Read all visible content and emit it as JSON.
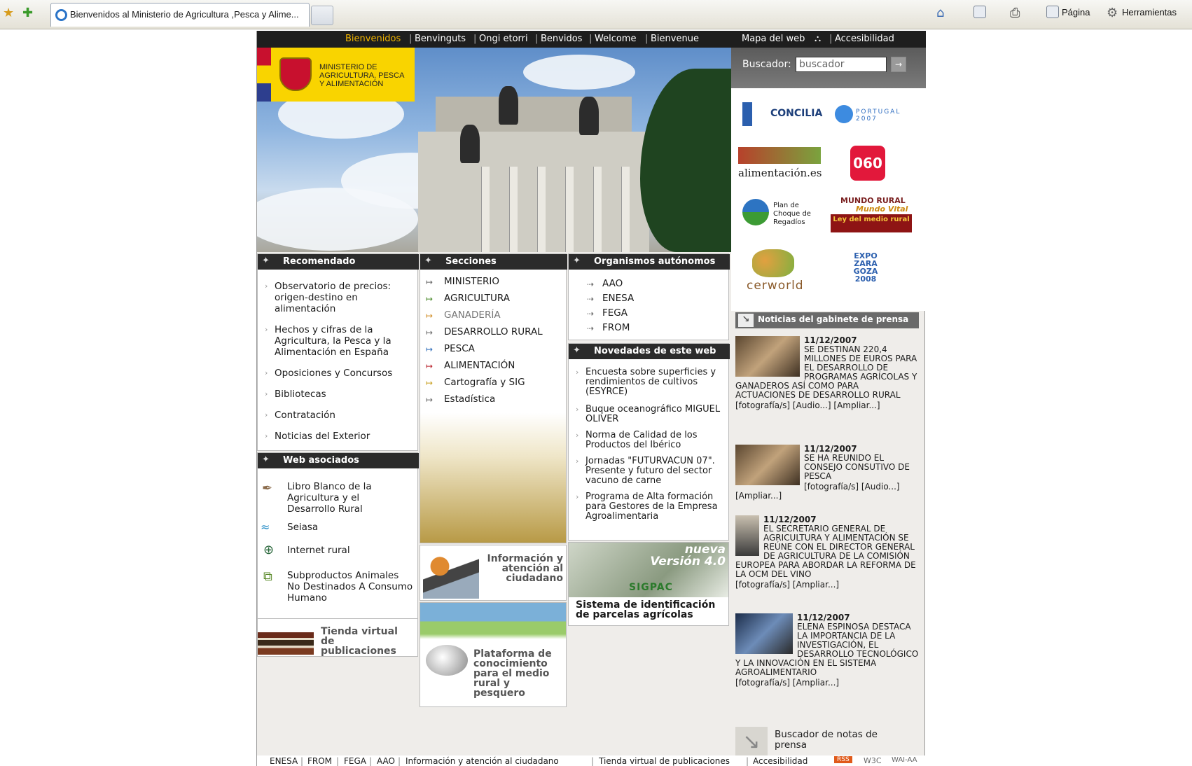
{
  "browser": {
    "tab_title": "Bienvenidos al Ministerio de Agricultura ,Pesca y Alime...",
    "menu_page": "Página",
    "menu_tools": "Herramientas"
  },
  "topnav": {
    "languages": [
      "Bienvenidos",
      "Benvinguts",
      "Ongi etorri",
      "Benvidos",
      "Welcome",
      "Bienvenue"
    ],
    "sitemap": "Mapa del web",
    "accessibility": "Accesibilidad"
  },
  "logo": {
    "line1": "MINISTERIO DE",
    "line2": "AGRICULTURA, PESCA",
    "line3": "Y ALIMENTACIÓN"
  },
  "search": {
    "label": "Buscador:",
    "placeholder": "buscador",
    "value": "buscador"
  },
  "partners": {
    "concilia": "CONCILIA",
    "portugal": "PORTUGAL 2007",
    "alimentacion": "alimentación.es",
    "n060": "060",
    "regadios": "Plan de Choque de Regadíos",
    "mundo_rural": "MUNDO RURAL",
    "mundo_vital": "Mundo Vital",
    "ley": "Ley del medio rural",
    "cerworld": "cerworld",
    "expo": "EXPO ZARA GOZA 2008"
  },
  "recomendado": {
    "title": "Recomendado",
    "items": [
      "Observatorio de precios: origen-destino en alimentación",
      "Hechos y cifras de la Agricultura, la Pesca y la Alimentación en España",
      "Oposiciones y Concursos",
      "Bibliotecas",
      "Contratación",
      "Noticias del Exterior"
    ]
  },
  "secciones": {
    "title": "Secciones",
    "items": [
      "MINISTERIO",
      "AGRICULTURA",
      "GANADERÍA",
      "DESARROLLO RURAL",
      "PESCA",
      "ALIMENTACIÓN",
      "Cartografía y SIG",
      "Estadística"
    ]
  },
  "organismos": {
    "title": "Organismos autónomos",
    "items": [
      "AAO",
      "ENESA",
      "FEGA",
      "FROM"
    ]
  },
  "novedades": {
    "title": "Novedades de este web",
    "items": [
      "Encuesta sobre superficies y rendimientos de cultivos (ESYRCE)",
      "Buque oceanográfico MIGUEL OLIVER",
      "Norma de Calidad de los Productos del Ibérico",
      "Jornadas \"FUTURVACUN 07\". Presente y futuro del sector vacuno de carne",
      "Programa de Alta formación para Gestores de la Empresa Agroalimentaria"
    ]
  },
  "web_asociados": {
    "title": "Web asociados",
    "items": [
      "Libro Blanco de la Agricultura y el Desarrollo Rural",
      "Seiasa",
      "Internet rural",
      "Subproductos Animales No Destinados A Consumo Humano"
    ]
  },
  "promos": {
    "info": "Información y atención al ciudadano",
    "plataforma": "Plataforma de conocimiento para el medio rural y pesquero",
    "tienda": "Tienda virtual de publicaciones",
    "sigpac_badge": "nueva Versión 4.0",
    "sigpac_logo": "SIGPAC",
    "sigpac_title": "Sistema de identificación de parcelas agrícolas"
  },
  "press": {
    "title": "Noticias del gabinete de prensa",
    "items": [
      {
        "date": "11/12/2007",
        "text": "SE DESTINAN 220,4 MILLONES DE EUROS PARA EL DESARROLLO DE PROGRAMAS AGRÍCOLAS Y GANADEROS ASÍ COMO PARA ACTUACIONES DE DESARROLLO RURAL",
        "links": "[fotografía/s]  [Audio...]  [Ampliar...]"
      },
      {
        "date": "11/12/2007",
        "text": "SE HA REUNIDO EL CONSEJO CONSUTIVO DE PESCA",
        "links": "[fotografía/s]  [Audio...]  [Ampliar...]"
      },
      {
        "date": "11/12/2007",
        "text": "EL SECRETARIO GENERAL DE AGRICULTURA Y ALIMENTACIÓN SE REÚNE CON EL DIRECTOR GENERAL DE AGRICULTURA DE LA COMISIÓN EUROPEA PARA ABORDAR LA REFORMA DE LA OCM DEL VINO",
        "links": "[fotografía/s]  [Ampliar...]"
      },
      {
        "date": "11/12/2007",
        "text": "ELENA ESPINOSA DESTACA LA IMPORTANCIA DE LA INVESTIGACIÓN, EL DESARROLLO TECNOLÓGICO Y LA INNOVACIÓN EN EL SISTEMA AGROALIMENTARIO",
        "links": "[fotografía/s]  [Ampliar...]"
      }
    ],
    "search_notes": "Buscador de notas de prensa"
  },
  "footer": {
    "links": [
      "ENESA",
      "FROM",
      "FEGA",
      "AAO",
      "Información y atención al ciudadano",
      "Tienda virtual de publicaciones",
      "Accesibilidad"
    ],
    "badges": [
      "RSS",
      "W3C",
      "WAI-AA"
    ]
  }
}
